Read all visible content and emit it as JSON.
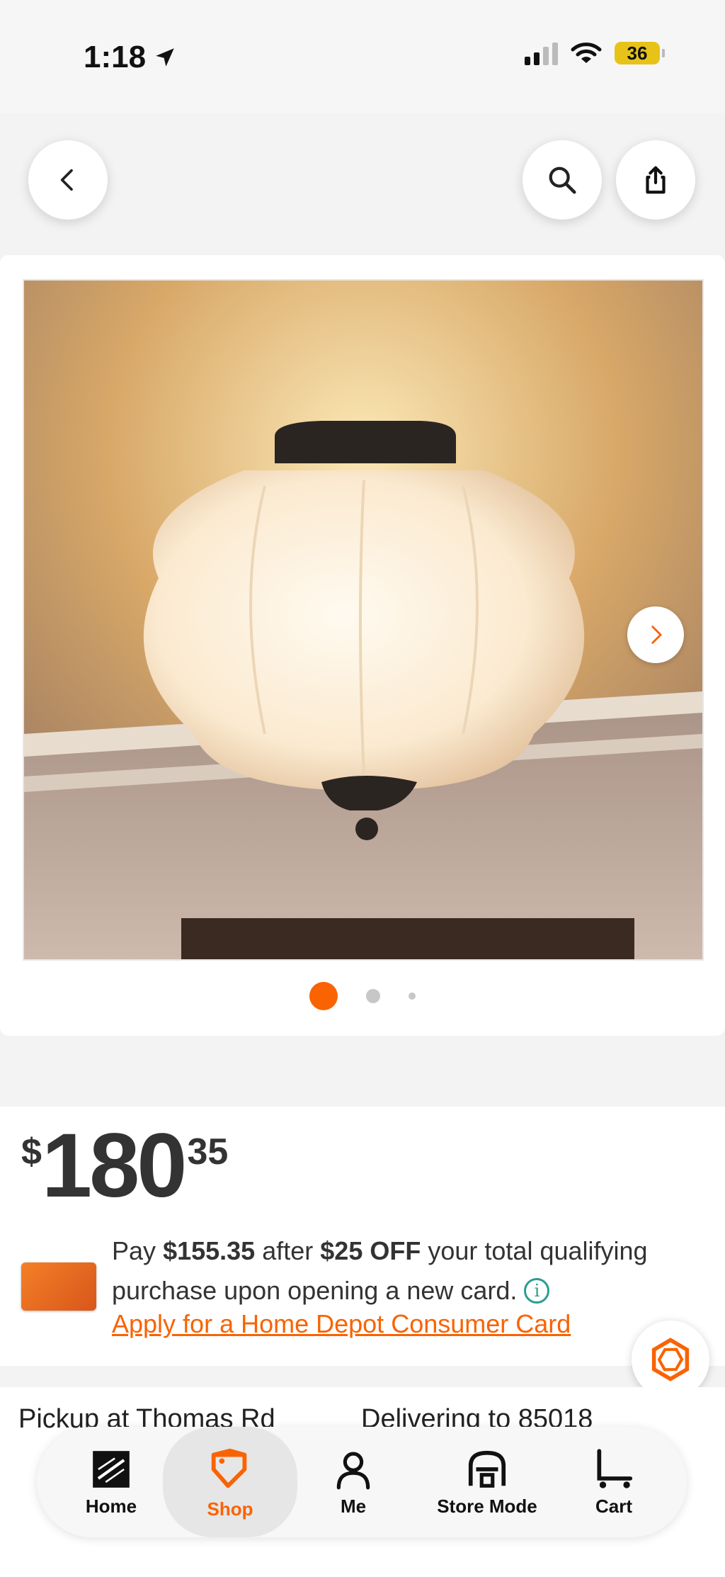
{
  "status_bar": {
    "time": "1:18",
    "battery": "36"
  },
  "top_nav": {
    "back": "back",
    "search": "search",
    "share": "share"
  },
  "gallery": {
    "slide_count": 3,
    "active_index": 0
  },
  "price": {
    "currency": "$",
    "dollars": "180",
    "cents": "35"
  },
  "promo": {
    "pay": "Pay",
    "amount": "$155.35",
    "after": "after",
    "discount": "$25 OFF",
    "rest": "your total qualifying purchase upon opening a new card.",
    "link": "Apply for a Home Depot Consumer Card"
  },
  "fulfillment": {
    "pickup": "Pickup at Thomas Rd",
    "delivery": "Delivering to 85018"
  },
  "tabs": [
    {
      "label": "Home",
      "icon": "home-depot-logo-icon"
    },
    {
      "label": "Shop",
      "icon": "shop-tag-icon"
    },
    {
      "label": "Me",
      "icon": "person-icon"
    },
    {
      "label": "Store Mode",
      "icon": "store-icon"
    },
    {
      "label": "Cart",
      "icon": "cart-icon"
    }
  ],
  "colors": {
    "brand_orange": "#f96302",
    "info_teal": "#2a9d8f"
  }
}
